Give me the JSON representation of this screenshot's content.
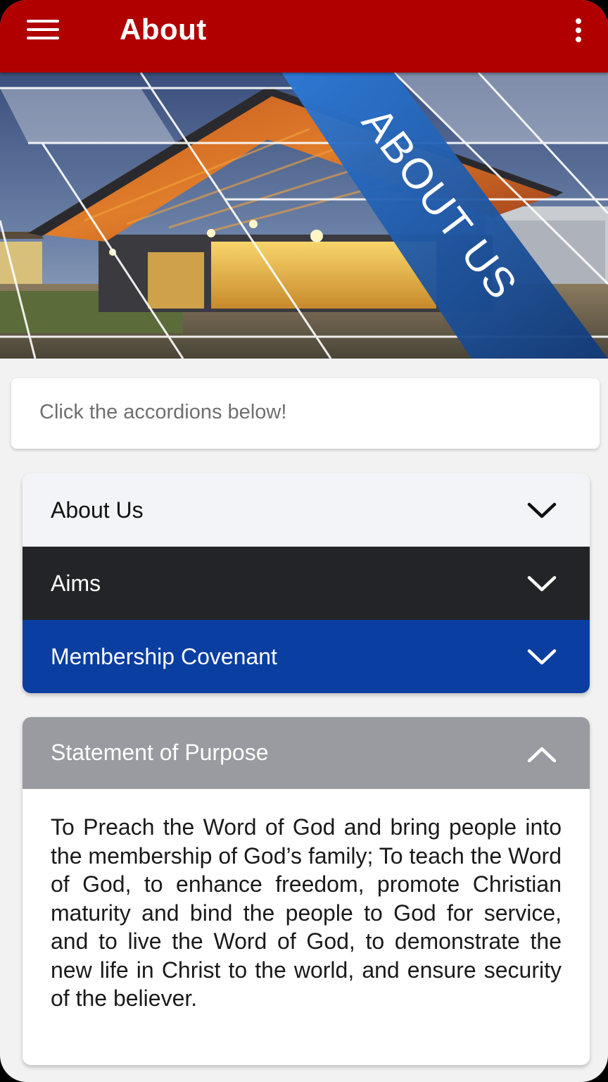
{
  "app_bar": {
    "title": "About",
    "color": "#b00000"
  },
  "hero": {
    "banner_text": "ABOUT US"
  },
  "hint": {
    "text": "Click the accordions below!"
  },
  "accordions": [
    {
      "label": "About Us",
      "expanded": false,
      "color": "#f3f4f8"
    },
    {
      "label": "Aims",
      "expanded": false,
      "color": "#222428"
    },
    {
      "label": "Membership Covenant",
      "expanded": false,
      "color": "#0a3ea1"
    }
  ],
  "statement": {
    "label": "Statement of Purpose",
    "expanded": true,
    "color": "#999ba0",
    "body": "To Preach the Word of God and bring people into the membership of God’s family; To teach the Word of God, to enhance freedom, promote Christian maturity and bind the people to God for service, and to live the Word of God, to demonstrate the new life in Christ to the world, and ensure security of the believer."
  }
}
